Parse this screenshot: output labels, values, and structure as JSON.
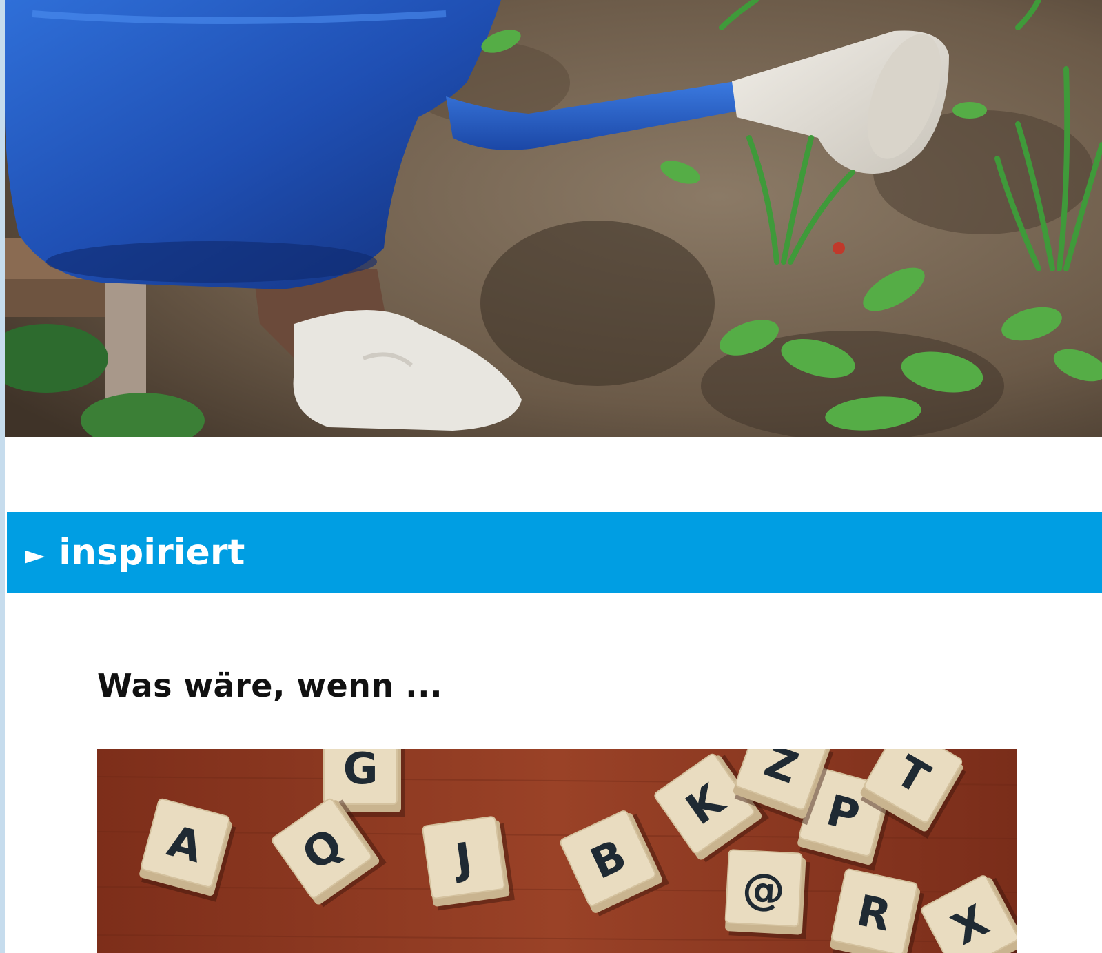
{
  "hero": {
    "image_name": "watering-can-garden-photo"
  },
  "section": {
    "arrow_glyph": "►",
    "title": "inspiriert",
    "color": "#009ee3"
  },
  "article": {
    "heading": "Was wäre, wenn ...",
    "image_name": "letter-blocks-photo",
    "tiles": [
      {
        "letter": "G"
      },
      {
        "letter": "K"
      },
      {
        "letter": "P"
      },
      {
        "letter": "T"
      },
      {
        "letter": "A"
      },
      {
        "letter": "Q"
      },
      {
        "letter": "J"
      },
      {
        "letter": "B"
      },
      {
        "letter": "@"
      },
      {
        "letter": "R"
      },
      {
        "letter": "X"
      },
      {
        "letter": "Z"
      }
    ]
  }
}
